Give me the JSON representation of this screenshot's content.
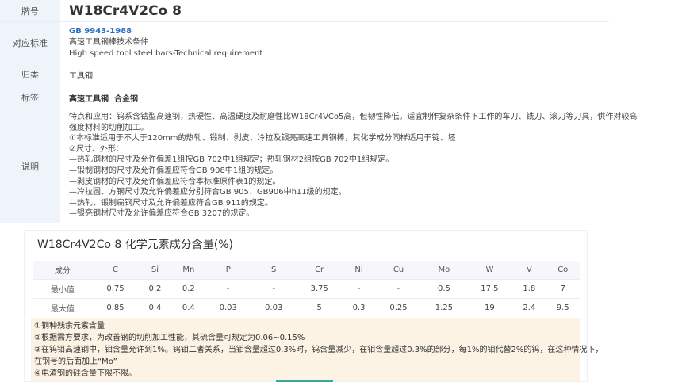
{
  "info": {
    "grade_label": "牌号",
    "grade_value": "W18Cr4V2Co 8",
    "standard_label": "对应标准",
    "standard_code": "GB 9943-1988",
    "standard_cn": "高速工具钢棒技术条件",
    "standard_en": "High speed tool steel bars-Technical requirement",
    "category_label": "归类",
    "category_value": "工具钢",
    "tags_label": "标签",
    "tags_value": "高速工具钢  合金钢",
    "desc_label": "说明",
    "desc_lines": [
      "特点和应用：钨系含钴型高速钢，热硬性、高温硬度及耐磨性比W18Cr4VCo5高，但韧性降低。适宜制作复杂条件下工作的车刀、铣刀、滚刀等刀具，供作对较高",
      "强度材料的切削加工。",
      "①本标准适用于不大于120mm的热轧、锻制、剥皮、冷拉及银亮高速工具钢棒，其化学成分同样适用于锭、坯",
      "②尺寸、外形：",
      "—热轧钢材的尺寸及允许偏差1组按GB 702中1组规定；热轧钢材2组按GB 702中1组规定。",
      "—锻制钢材的尺寸及允许偏差应符合GB 908中1组的规定。",
      "—剥皮钢材的尺寸及允许偏差应符合本标准原件表1的规定。",
      "—冷拉圆、方钢尺寸及允许偏差应分别符合GB 905、GB906中h11级的规定。",
      "—热轧、锻制扁钢尺寸及允许偏差应符合GB 911的规定。",
      "—银亮钢材尺寸及允许偏差应符合GB 3207的规定。"
    ]
  },
  "chem": {
    "title": "W18Cr4V2Co 8 化学元素成分含量(%)",
    "headers": [
      "成分",
      "C",
      "Si",
      "Mn",
      "P",
      "S",
      "Cr",
      "Ni",
      "Cu",
      "Mo",
      "W",
      "V",
      "Co"
    ],
    "rows": [
      [
        "最小值",
        "0.75",
        "0.2",
        "0.2",
        "-",
        "-",
        "3.75",
        "-",
        "-",
        "0.5",
        "17.5",
        "1.8",
        "7"
      ],
      [
        "最大值",
        "0.85",
        "0.4",
        "0.4",
        "0.03",
        "0.03",
        "5",
        "0.3",
        "0.25",
        "1.25",
        "19",
        "2.4",
        "9.5"
      ]
    ],
    "notes": [
      "①钢种残余元素含量",
      "②根据需方要求，为改善钢的切削加工性能，其硫含量可规定为0.06~0.15%",
      "③在钨钼高速钢中，钼含量允许到1%。钨钼二者关系，当钼含量超过0.3%时，钨含量减少，在钼含量超过0.3%的部分，每1%的钼代替2%的钨，在这种情况下，",
      "在钢号的后面加上“Mo”",
      "④电渣钢的硅含量下限不限。"
    ]
  },
  "colors": {
    "label_bg": "#eef4fa",
    "link": "#2b6cc4",
    "notes_bg": "#fdf3e4",
    "tab_accent": "#3aa6a0"
  }
}
